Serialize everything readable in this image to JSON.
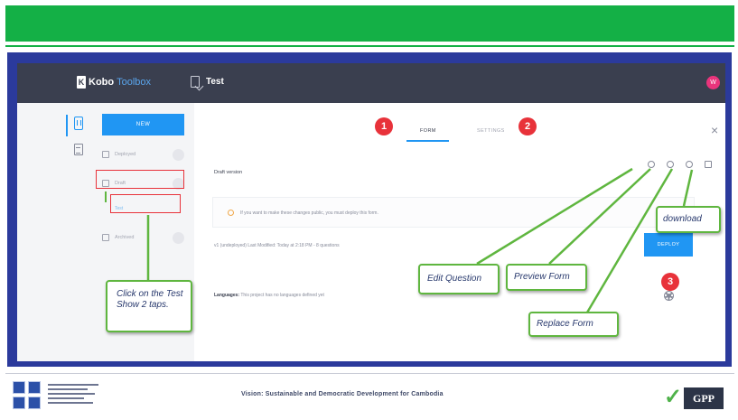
{
  "app": {
    "logo_mark": "K",
    "logo_name": "Kobo",
    "logo_suffix": "Toolbox",
    "project_title": "Test",
    "avatar_initial": "W"
  },
  "sidebar": {
    "new_label": "NEW",
    "items": [
      {
        "label": "Deployed"
      },
      {
        "label": "Draft"
      },
      {
        "label": "Archived"
      }
    ],
    "sub_item": "Test"
  },
  "tabs": {
    "form": "FORM",
    "settings": "SETTINGS"
  },
  "form_view": {
    "draft_label": "Draft version",
    "warning": "If you want to make these changes public, you must deploy this form.",
    "meta": "v1 (undeployed) Last Modified: Today at 2:18 PM - 8 questions",
    "deploy_label": "DEPLOY",
    "languages_key": "Languages:",
    "languages_value": "This project has no languages defined yet"
  },
  "markers": [
    "1",
    "2",
    "3"
  ],
  "callouts": {
    "tab_hint": "Click on the Test Show 2 taps.",
    "edit": "Edit Question",
    "preview": "Preview Form",
    "replace": "Replace Form",
    "download": "download"
  },
  "footer": {
    "vision": "Vision: Sustainable and Democratic Development for Cambodia",
    "gpp_label": "GPP",
    "gpp_check": "✓"
  },
  "colors": {
    "banner": "#14b046",
    "frame": "#2b3a9c",
    "appbar": "#3a3f4f",
    "accent": "#2096f3",
    "marker": "#e8323a",
    "callout_border": "#5fb63f"
  }
}
